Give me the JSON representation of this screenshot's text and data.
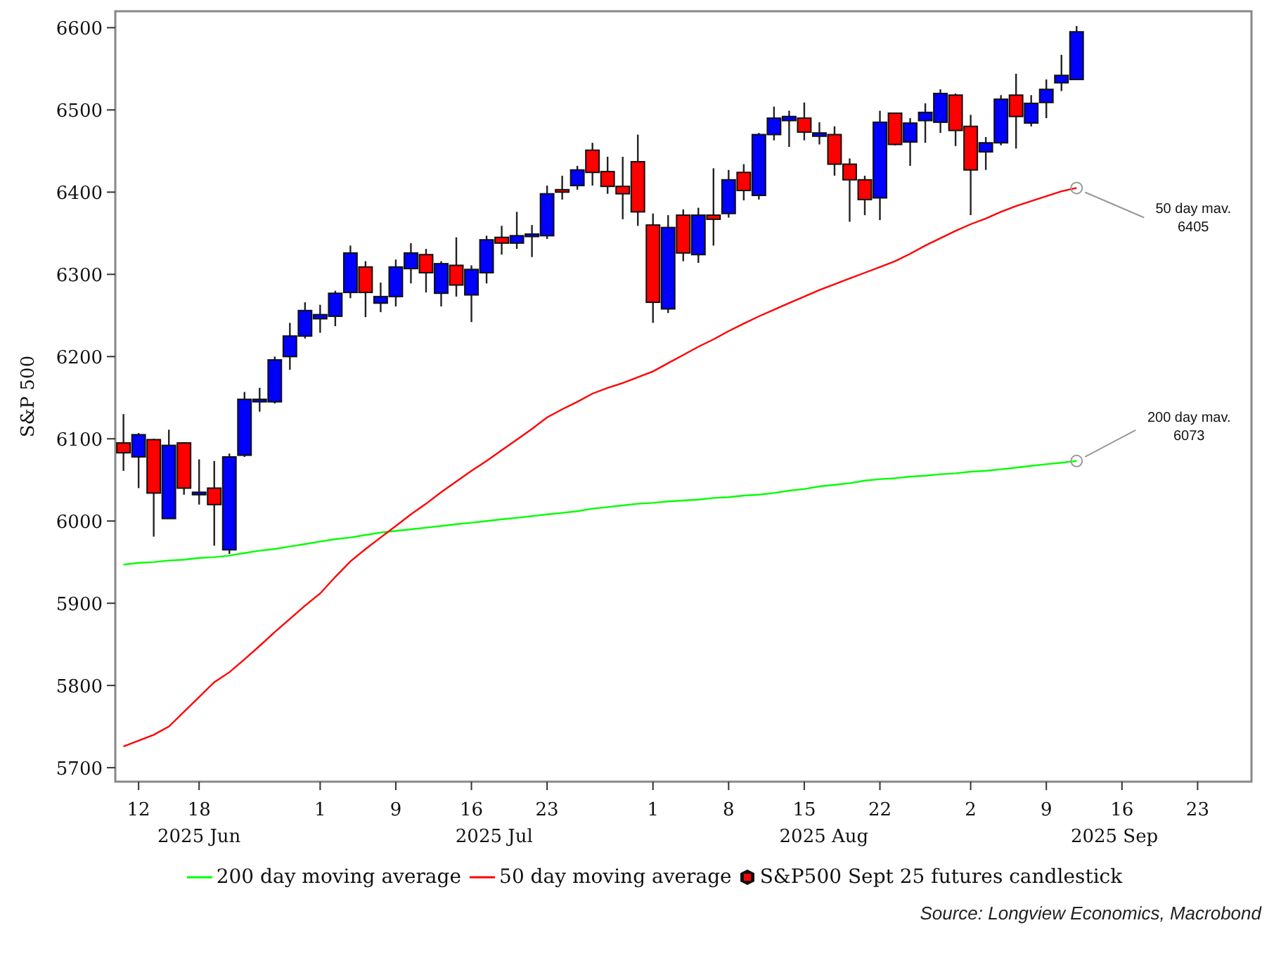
{
  "chart": {
    "chart_data": {
      "type": "candlestick",
      "ylabel": "S&P 500",
      "categories": [
        null,
        "12",
        null,
        null,
        null,
        "18",
        null,
        null,
        null,
        null,
        null,
        null,
        null,
        "1",
        null,
        null,
        null,
        null,
        "9",
        null,
        null,
        null,
        null,
        "16",
        null,
        null,
        null,
        null,
        "23",
        null,
        null,
        null,
        null,
        null,
        null,
        "1",
        null,
        null,
        null,
        null,
        "8",
        null,
        null,
        null,
        null,
        "15",
        null,
        null,
        null,
        null,
        "22",
        null,
        null,
        null,
        null,
        null,
        "2",
        null,
        null,
        null,
        null,
        "9",
        null,
        null,
        null,
        null,
        "16",
        null,
        null,
        null,
        null,
        "23",
        null,
        null,
        null
      ],
      "ylim": [
        5683,
        6620
      ],
      "yticks": [
        5700,
        5800,
        5900,
        6000,
        6100,
        6200,
        6300,
        6400,
        6500,
        6600
      ],
      "ohlc": [
        [
          6095,
          6130,
          6061,
          6083
        ],
        [
          6078,
          6107,
          6040,
          6105
        ],
        [
          6099,
          6100,
          5981,
          6034
        ],
        [
          6003,
          6111,
          6003,
          6092
        ],
        [
          6095,
          6096,
          6032,
          6040
        ],
        [
          6032,
          6075,
          6020,
          6035
        ],
        [
          6040,
          6073,
          5970,
          6020
        ],
        [
          5965,
          6082,
          5960,
          6078
        ],
        [
          6080,
          6157,
          6078,
          6148
        ],
        [
          6145,
          6162,
          6133,
          6148
        ],
        [
          6145,
          6200,
          6143,
          6196
        ],
        [
          6200,
          6241,
          6184,
          6225
        ],
        [
          6225,
          6266,
          6222,
          6256
        ],
        [
          6246,
          6263,
          6229,
          6251
        ],
        [
          6249,
          6280,
          6237,
          6277
        ],
        [
          6278,
          6335,
          6271,
          6326
        ],
        [
          6309,
          6316,
          6248,
          6278
        ],
        [
          6265,
          6290,
          6254,
          6273
        ],
        [
          6273,
          6318,
          6261,
          6309
        ],
        [
          6307,
          6338,
          6289,
          6326
        ],
        [
          6324,
          6331,
          6278,
          6302
        ],
        [
          6277,
          6316,
          6261,
          6313
        ],
        [
          6311,
          6345,
          6273,
          6287
        ],
        [
          6275,
          6311,
          6242,
          6306
        ],
        [
          6302,
          6347,
          6289,
          6342
        ],
        [
          6345,
          6359,
          6324,
          6338
        ],
        [
          6338,
          6376,
          6331,
          6347
        ],
        [
          6346,
          6360,
          6321,
          6349
        ],
        [
          6347,
          6408,
          6343,
          6398
        ],
        [
          6403,
          6420,
          6391,
          6400
        ],
        [
          6408,
          6432,
          6403,
          6427
        ],
        [
          6451,
          6460,
          6408,
          6424
        ],
        [
          6425,
          6443,
          6398,
          6407
        ],
        [
          6407,
          6443,
          6367,
          6398
        ],
        [
          6437,
          6470,
          6359,
          6376
        ],
        [
          6360,
          6374,
          6241,
          6266
        ],
        [
          6258,
          6372,
          6253,
          6357
        ],
        [
          6372,
          6379,
          6316,
          6326
        ],
        [
          6324,
          6381,
          6314,
          6372
        ],
        [
          6372,
          6429,
          6335,
          6367
        ],
        [
          6374,
          6427,
          6369,
          6415
        ],
        [
          6424,
          6434,
          6390,
          6402
        ],
        [
          6396,
          6472,
          6391,
          6470
        ],
        [
          6470,
          6504,
          6463,
          6490
        ],
        [
          6487,
          6499,
          6455,
          6492
        ],
        [
          6490,
          6509,
          6463,
          6473
        ],
        [
          6468,
          6485,
          6458,
          6472
        ],
        [
          6470,
          6480,
          6420,
          6434
        ],
        [
          6434,
          6441,
          6364,
          6415
        ],
        [
          6415,
          6420,
          6372,
          6391
        ],
        [
          6393,
          6499,
          6366,
          6485
        ],
        [
          6496,
          6496,
          6457,
          6458
        ],
        [
          6461,
          6490,
          6432,
          6484
        ],
        [
          6487,
          6508,
          6460,
          6497
        ],
        [
          6485,
          6525,
          6472,
          6520
        ],
        [
          6518,
          6520,
          6456,
          6475
        ],
        [
          6480,
          6494,
          6372,
          6427
        ],
        [
          6449,
          6467,
          6427,
          6460
        ],
        [
          6460,
          6518,
          6457,
          6513
        ],
        [
          6518,
          6544,
          6453,
          6492
        ],
        [
          6484,
          6518,
          6480,
          6508
        ],
        [
          6509,
          6537,
          6490,
          6525
        ],
        [
          6533,
          6567,
          6523,
          6542
        ],
        [
          6537,
          6602,
          6537,
          6595
        ],
        null,
        null,
        null,
        null,
        null,
        null,
        null,
        null,
        null,
        null,
        null
      ],
      "series": [
        {
          "name": "200 day moving average",
          "type": "line",
          "color": "#00ff00",
          "values": [
            5947,
            5949,
            5950,
            5952,
            5953,
            5955,
            5956,
            5958,
            5961,
            5964,
            5966,
            5969,
            5972,
            5975,
            5978,
            5980,
            5983,
            5986,
            5988,
            5990,
            5992,
            5994,
            5996,
            5998,
            6000,
            6002,
            6004,
            6006,
            6008,
            6010,
            6012,
            6015,
            6017,
            6019,
            6021,
            6022,
            6024,
            6025,
            6026,
            6028,
            6029,
            6031,
            6032,
            6034,
            6037,
            6039,
            6042,
            6044,
            6046,
            6049,
            6051,
            6052,
            6054,
            6055,
            6057,
            6058,
            6060,
            6061,
            6063,
            6065,
            6067,
            6069,
            6071,
            6073,
            null,
            null,
            null,
            null,
            null,
            null,
            null,
            null,
            null,
            null,
            null
          ]
        },
        {
          "name": "50 day moving average",
          "type": "line",
          "color": "#ff0000",
          "values": [
            5726,
            5733,
            5740,
            5750,
            5768,
            5786,
            5804,
            5816,
            5832,
            5848,
            5865,
            5881,
            5897,
            5912,
            5932,
            5951,
            5966,
            5980,
            5994,
            6008,
            6021,
            6035,
            6048,
            6061,
            6073,
            6086,
            6099,
            6112,
            6126,
            6136,
            6145,
            6155,
            6162,
            6168,
            6175,
            6182,
            6192,
            6202,
            6212,
            6221,
            6231,
            6240,
            6249,
            6257,
            6265,
            6273,
            6281,
            6288,
            6295,
            6302,
            6309,
            6316,
            6325,
            6335,
            6344,
            6353,
            6361,
            6368,
            6376,
            6383,
            6389,
            6395,
            6401,
            6405,
            null,
            null,
            null,
            null,
            null,
            null,
            null,
            null,
            null,
            null,
            null
          ]
        }
      ],
      "annotations": [
        "50 day mav.\n6405",
        "200 day mav.\n6073"
      ]
    },
    "month_labels": [
      "2025 Jun",
      "2025 Jul",
      "2025 Aug",
      "2025 Sep"
    ],
    "candle_legend": "S&P500 Sept 25 futures candlestick"
  },
  "source": "Source: Longview Economics, Macrobond"
}
